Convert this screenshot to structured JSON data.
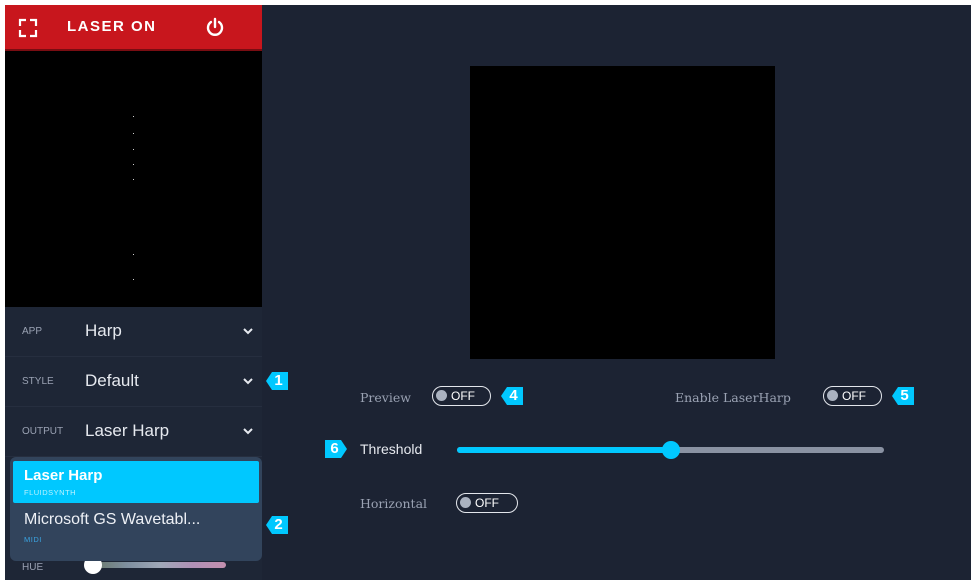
{
  "header": {
    "title": "LASER ON",
    "fullscreen_icon": "fullscreen-icon",
    "power_icon": "power-icon"
  },
  "settings": [
    {
      "label": "APP",
      "value": "Harp"
    },
    {
      "label": "STYLE",
      "value": "Default"
    },
    {
      "label": "OUTPUT",
      "value": "Laser Harp"
    }
  ],
  "output_dropdown": {
    "options": [
      {
        "name": "Laser Harp",
        "subtitle": "FLUIDSYNTH",
        "selected": true
      },
      {
        "name": "Microsoft GS Wavetabl...",
        "subtitle": "MIDI",
        "selected": false
      }
    ]
  },
  "hue": {
    "label": "HUE",
    "value": 0.0
  },
  "controls": {
    "preview": {
      "label": "Preview",
      "state": "OFF"
    },
    "enable_laserharp": {
      "label": "Enable LaserHarp",
      "state": "OFF"
    },
    "threshold": {
      "label": "Threshold",
      "value": 0.5
    },
    "horizontal": {
      "label": "Horizontal",
      "state": "OFF"
    }
  },
  "callouts": [
    "1",
    "2",
    "4",
    "5",
    "6"
  ],
  "colors": {
    "accent": "#00c8ff",
    "header_red": "#c8161d",
    "background": "#1c2333",
    "sidebar": "#1e2636"
  }
}
